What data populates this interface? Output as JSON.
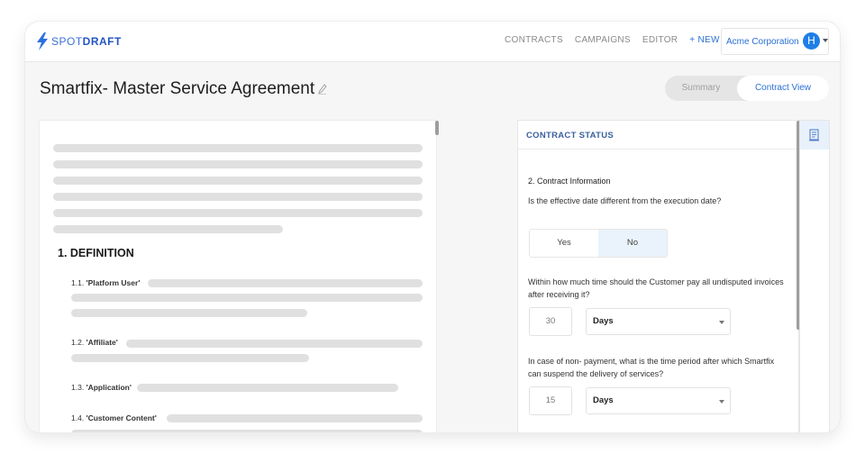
{
  "brand": {
    "logo_spot": "SPOT",
    "logo_draft": "DRAFT",
    "accent": "#2a6fd6"
  },
  "nav": {
    "items": [
      "CONTRACTS",
      "CAMPAIGNS",
      "EDITOR"
    ],
    "new_label": "+ NEW",
    "org_name": "Acme Corporation",
    "avatar_letter": "H"
  },
  "page": {
    "title": "Smartfix- Master Service Agreement",
    "view_toggle": {
      "summary": "Summary",
      "contract_view": "Contract View",
      "active": "Contract View"
    }
  },
  "document": {
    "section_heading": "1. DEFINITION",
    "definitions": [
      {
        "number": "1.1.",
        "term": "'Platform User'"
      },
      {
        "number": "1.2.",
        "term": "'Affiliate'"
      },
      {
        "number": "1.3.",
        "term": "'Application'"
      },
      {
        "number": "1.4.",
        "term": "'Customer Content'"
      }
    ]
  },
  "contract_status": {
    "header": "CONTRACT STATUS",
    "section": "2. Contract Information",
    "q1": {
      "text": "Is the effective date different from the execution date?",
      "yes_label": "Yes",
      "no_label": "No",
      "selected": "No"
    },
    "q2": {
      "text": "Within how much time should the Customer pay all undisputed invoices after receiving it?",
      "value": "30",
      "unit": "Days"
    },
    "q3": {
      "text": "In case of non- payment, what is the time period after which Smartfix can suspend the delivery of services?",
      "value": "15",
      "unit": "Days"
    }
  }
}
